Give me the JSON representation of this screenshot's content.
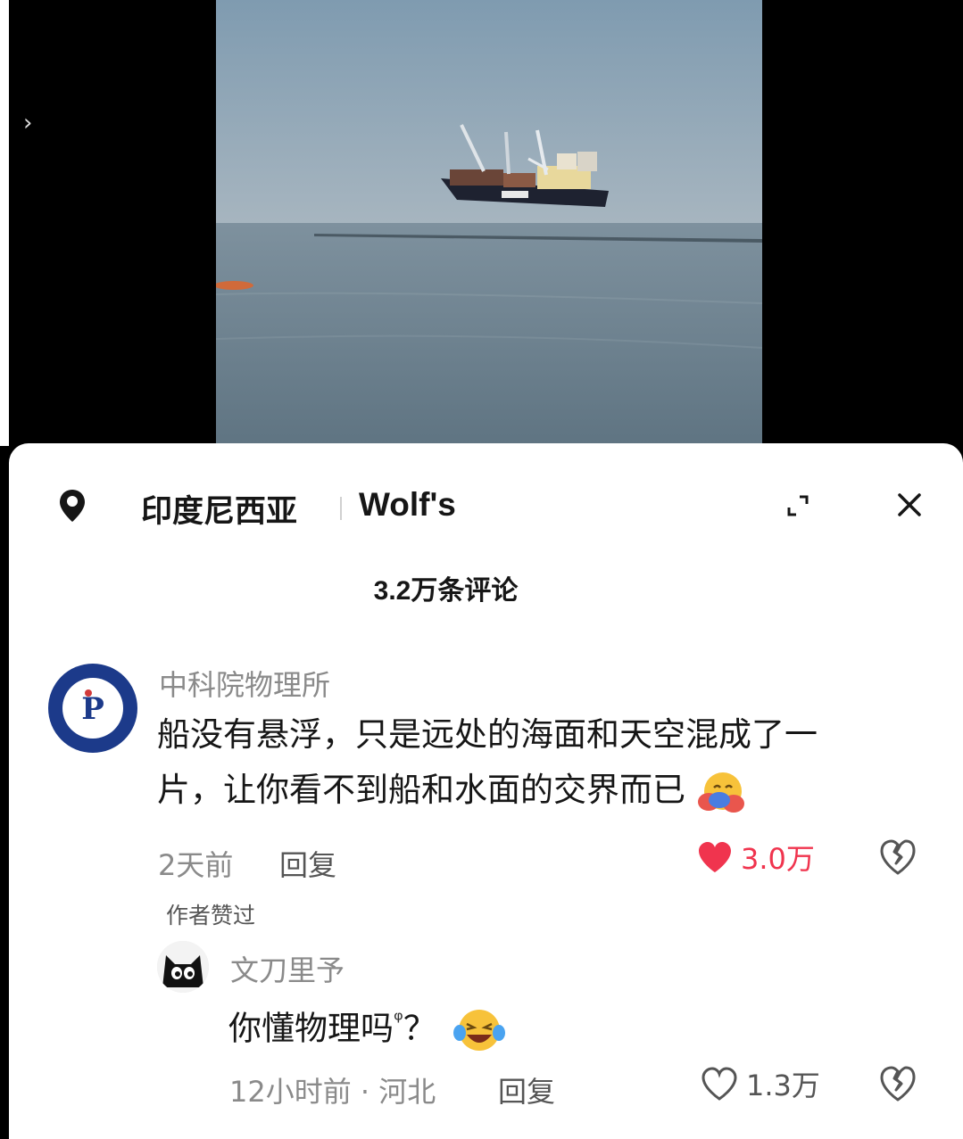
{
  "video": {
    "expand_glyph": "›",
    "sky_color": "#8ea2b2",
    "sea_color": "#6f8594"
  },
  "header": {
    "location": "印度尼西亚",
    "tag": "Wolf's",
    "icons": [
      "location-pin-icon",
      "collapse-icon",
      "close-icon"
    ]
  },
  "comments_count": "3.2万条评论",
  "comments": [
    {
      "username": "中科院物理所",
      "text_line1": "船没有悬浮，只是远处的海面和天空混成了一",
      "text_line2": "片，让你看不到船和水面的交界而已",
      "emoji": "hugging-face-emoji",
      "time": "2天前",
      "reply_label": "回复",
      "likes": "3.0万",
      "liked": true,
      "liked_color": "#f0344e",
      "author_liked": "作者赞过"
    },
    {
      "username": "文刀里予",
      "text": "你懂物理吗",
      "search_glyph": "ᵠ",
      "text_suffix": "？",
      "emoji": "laughing-tears-emoji",
      "time_location": "12小时前 · 河北",
      "reply_label": "回复",
      "likes": "1.3万",
      "liked": false
    }
  ]
}
